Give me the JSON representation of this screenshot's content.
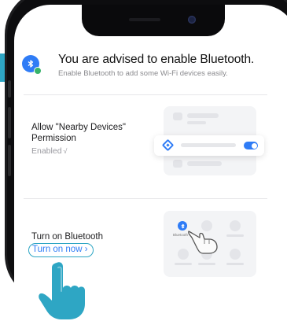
{
  "banner": {
    "title": "You are advised to enable Bluetooth.",
    "subtitle": "Enable Bluetooth to add some Wi-Fi devices easily.",
    "icon": "bluetooth-icon"
  },
  "permission": {
    "title": "Allow \"Nearby Devices\" Permission",
    "status": "Enabled",
    "status_mark": "√",
    "toggle_on": true
  },
  "bluetooth": {
    "title": "Turn on Bluetooth",
    "action_label": "Turn on now",
    "action_chevron": "›",
    "illustration_label": "Bluetooth"
  },
  "colors": {
    "accent": "#2f7cf6",
    "highlight": "#2ea6c4",
    "enabled_check": "#37b36a",
    "muted_text": "#9a9aa0"
  }
}
